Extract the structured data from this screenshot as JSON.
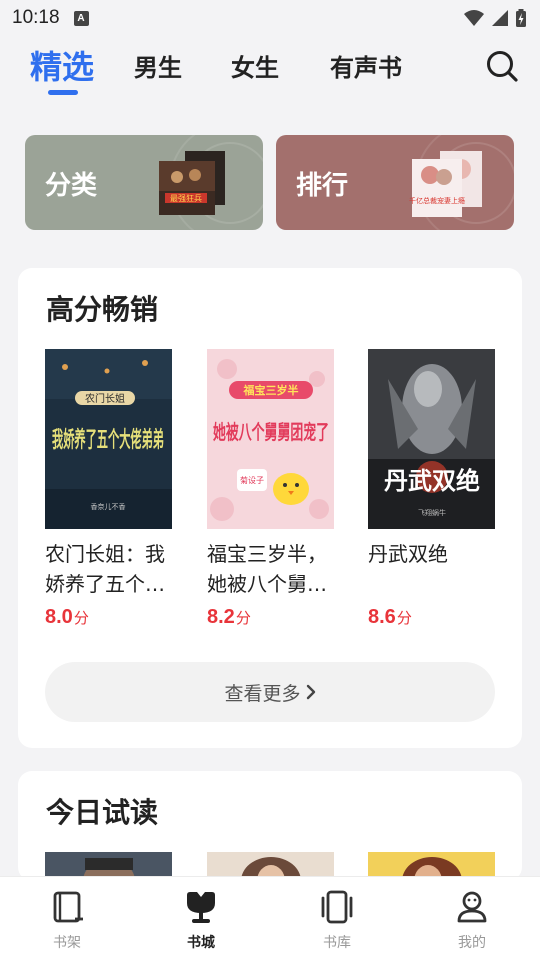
{
  "status_bar": {
    "time": "10:18",
    "notification_letter": "A"
  },
  "top_tabs": [
    {
      "label": "精选",
      "active": true
    },
    {
      "label": "男生",
      "active": false
    },
    {
      "label": "女生",
      "active": false
    },
    {
      "label": "有声书",
      "active": false
    }
  ],
  "categories": [
    {
      "label": "分类",
      "cover_text": "最强狂兵"
    },
    {
      "label": "排行",
      "cover_text": "千亿总裁宠妻上瘾"
    }
  ],
  "high_score": {
    "title": "高分畅销",
    "books": [
      {
        "title": "农门长姐：我娇养了五个…",
        "score": "8.0",
        "unit": "分",
        "cover_main": "我娇养了五个大佬弟弟",
        "cover_tag": "农门长姐",
        "cover_author": "香奈儿不香"
      },
      {
        "title": "福宝三岁半，她被八个舅…",
        "score": "8.2",
        "unit": "分",
        "cover_main": "她被八个舅舅团宠了",
        "cover_tag": "福宝三岁半",
        "cover_author": "菊设子"
      },
      {
        "title": "丹武双绝",
        "score": "8.6",
        "unit": "分",
        "cover_main": "丹武双绝",
        "cover_tag": "",
        "cover_author": "飞翔蜗牛"
      }
    ],
    "more_label": "查看更多"
  },
  "daily_trial": {
    "title": "今日试读"
  },
  "bottom_nav": [
    {
      "label": "书架",
      "icon": "bookshelf-icon",
      "active": false
    },
    {
      "label": "书城",
      "icon": "bookstore-icon",
      "active": true
    },
    {
      "label": "书库",
      "icon": "library-icon",
      "active": false
    },
    {
      "label": "我的",
      "icon": "profile-icon",
      "active": false
    }
  ],
  "colors": {
    "accent": "#2f6fee",
    "score": "#e8343a",
    "fenlei_bg": "#9ba397",
    "paihang_bg": "#a3706d"
  }
}
